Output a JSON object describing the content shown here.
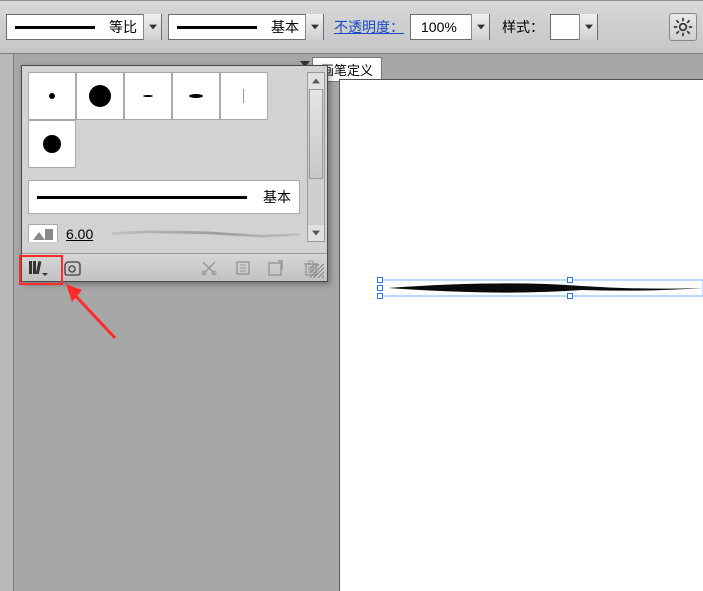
{
  "toolbar": {
    "ratio_label": "等比",
    "basic_label": "基本",
    "opacity_label": "不透明度：",
    "opacity_value": "100%",
    "style_label": "样式："
  },
  "tooltip": {
    "text": "画笔定义"
  },
  "panel": {
    "stroke_label": "基本",
    "number": "6.00"
  }
}
